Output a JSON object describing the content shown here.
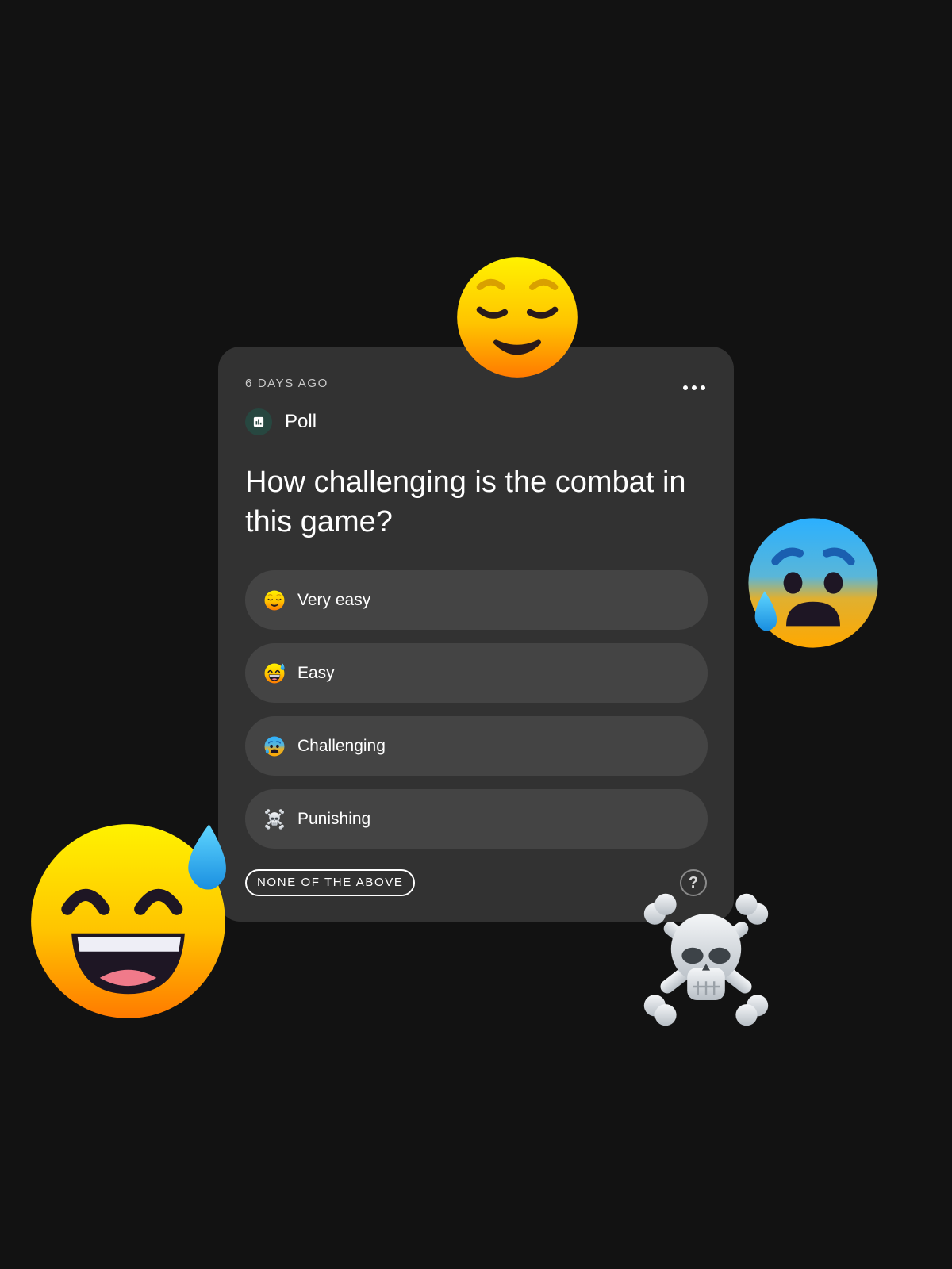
{
  "card": {
    "timestamp": "6 DAYS AGO",
    "type_label": "Poll",
    "question": "How challenging is the combat in this game?",
    "options": [
      {
        "label": "Very easy",
        "icon": "relieved-face-icon"
      },
      {
        "label": "Easy",
        "icon": "grinning-face-with-sweat-icon"
      },
      {
        "label": "Challenging",
        "icon": "anxious-face-with-sweat-icon"
      },
      {
        "label": "Punishing",
        "icon": "skull-and-crossbones-icon"
      }
    ],
    "none_label": "NONE OF THE ABOVE",
    "help_label": "?"
  },
  "decorations": [
    "relieved-face-icon",
    "anxious-face-with-sweat-icon",
    "grinning-face-with-sweat-icon",
    "skull-and-crossbones-icon"
  ],
  "colors": {
    "background": "#121212",
    "card": "#323232",
    "option": "#444444",
    "poll_badge": "#274740"
  }
}
